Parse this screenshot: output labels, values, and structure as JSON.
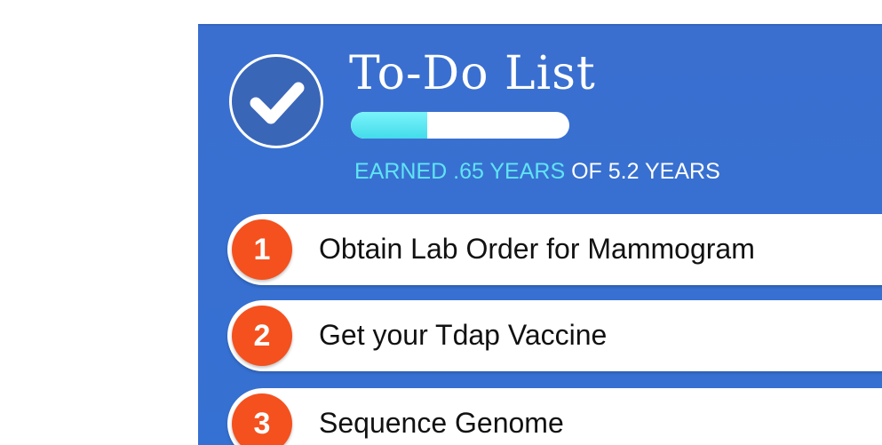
{
  "todo": {
    "title": "To-Do List",
    "progress_fraction": 0.35,
    "earned_prefix": "EARNED .65 YEARS",
    "earned_suffix": " OF 5.2 YEARS"
  },
  "tasks": [
    {
      "number": "1",
      "label": "Obtain Lab Order for Mammogram"
    },
    {
      "number": "2",
      "label": "Get your Tdap Vaccine"
    },
    {
      "number": "3",
      "label": "Sequence Genome"
    }
  ],
  "colors": {
    "panel": "#3571d2",
    "progress": "#5fe4f4",
    "badge": "#f4511e"
  },
  "icons": {
    "header": "checkmark-icon"
  }
}
